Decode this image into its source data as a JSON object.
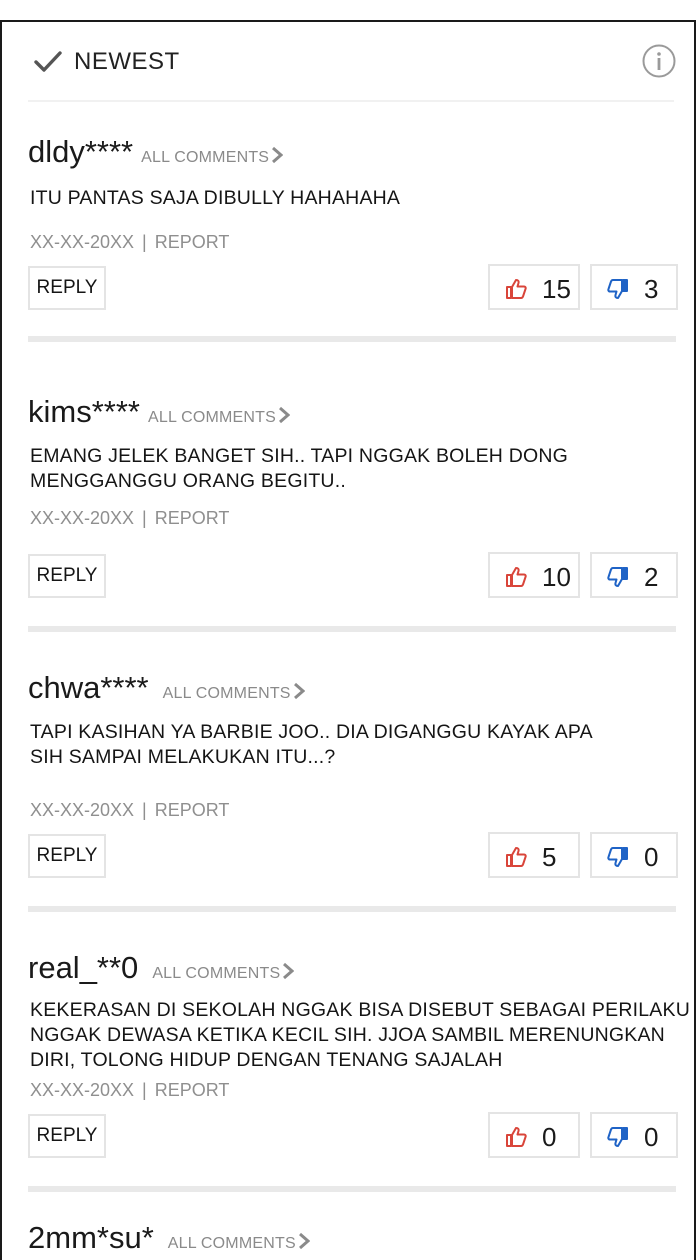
{
  "header": {
    "sort_label": "NEWEST"
  },
  "comments": [
    {
      "username": "dldy****",
      "all_comments": "ALL COMMENTS",
      "text": "ITU PANTAS SAJA DIBULLY HAHAHAHA",
      "date": "XX-XX-20XX",
      "report": "REPORT",
      "reply": "REPLY",
      "likes": "15",
      "dislikes": "3"
    },
    {
      "username": "kims****",
      "all_comments": "ALL COMMENTS",
      "text": "EMANG JELEK BANGET SIH.. TAPI NGGAK BOLEH DONG MENGGANGGU ORANG BEGITU..",
      "date": "XX-XX-20XX",
      "report": "REPORT",
      "reply": "REPLY",
      "likes": "10",
      "dislikes": "2"
    },
    {
      "username": "chwa****",
      "all_comments": "ALL COMMENTS",
      "text": "TAPI KASIHAN YA BARBIE JOO.. DIA DIGANGGU KAYAK APA SIH SAMPAI MELAKUKAN ITU...?",
      "date": "XX-XX-20XX",
      "report": "REPORT",
      "reply": "REPLY",
      "likes": "5",
      "dislikes": "0"
    },
    {
      "username": "real_**0",
      "all_comments": "ALL COMMENTS",
      "text": "KEKERASAN DI SEKOLAH NGGAK BISA DISEBUT SEBAGAI PERILAKU NGGAK DEWASA KETIKA KECIL SIH. JJOA SAMBIL MERENUNGKAN DIRI, TOLONG HIDUP DENGAN TENANG SAJALAH",
      "date": "XX-XX-20XX",
      "report": "REPORT",
      "reply": "REPLY",
      "likes": "0",
      "dislikes": "0"
    },
    {
      "username": "2mm*su*",
      "all_comments": "ALL COMMENTS"
    }
  ],
  "colors": {
    "like": "#d9453a",
    "dislike": "#1f63c6",
    "muted_text": "#8f8f8f",
    "divider": "#e9e9e9"
  },
  "icons": {
    "sort": "check-icon",
    "info": "info-icon",
    "like": "thumbs-up-icon",
    "dislike": "thumbs-down-icon",
    "all_comments": "chevron-right-icon"
  }
}
